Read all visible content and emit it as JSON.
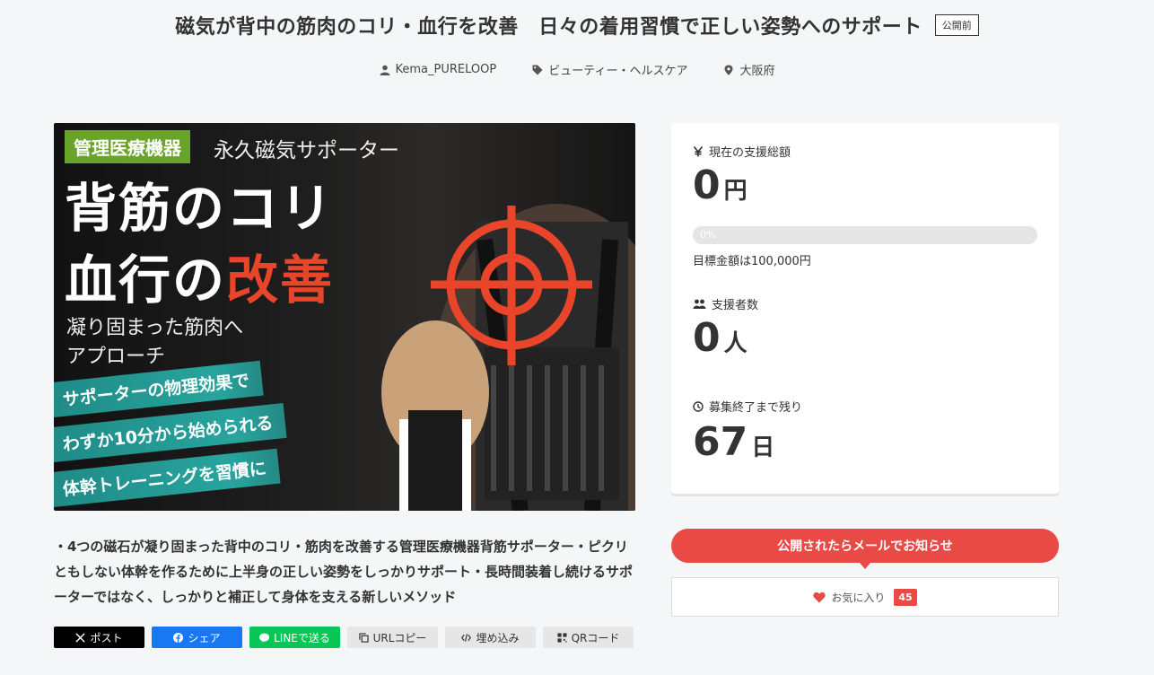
{
  "project": {
    "title": "磁気が背中の筋肉のコリ・血行を改善　日々の着用習慣で正しい姿勢へのサポート",
    "status_badge": "公開前",
    "owner": "Kema_PURELOOP",
    "category": "ビューティー・ヘルスケア",
    "location": "大阪府",
    "description": "・4つの磁石が凝り固まった背中のコリ・筋肉を改善する管理医療機器背筋サポーター・ピクリともしない体幹を作るために上半身の正しい姿勢をしっかりサポート・長時間装着し続けるサポーターではなく、しっかりと補正して身体を支える新しいメソッド"
  },
  "hero": {
    "tag": "管理医療機器",
    "tag_sub": "永久磁気サポーター",
    "headline_line1": "背筋のコリ",
    "headline_line2_a": "血行の",
    "headline_line2_b": "改善",
    "sub_line1": "凝り固まった筋肉へ",
    "sub_line2": "アプローチ",
    "band1": "サポーターの物理効果で",
    "band2": "わずか10分から始められる",
    "band3": "体幹トレーニングを習慣に",
    "accent_color": "#e8452b",
    "band_color": "#28a49e"
  },
  "share": {
    "x_label": "ポスト",
    "facebook_label": "シェア",
    "line_label": "LINEで送る",
    "url_label": "URLコピー",
    "embed_label": "埋め込み",
    "qr_label": "QRコード"
  },
  "stats": {
    "amount_label": "現在の支援総額",
    "amount_value": "0",
    "amount_unit": "円",
    "progress_percent_text": "0%",
    "progress_fraction": 0,
    "goal_text": "目標金額は100,000円",
    "backers_label": "支援者数",
    "backers_value": "0",
    "backers_unit": "人",
    "remaining_label": "募集終了まで残り",
    "remaining_value": "67",
    "remaining_unit": "日"
  },
  "actions": {
    "notify_label": "公開されたらメールでお知らせ",
    "favorite_label": "お気に入り",
    "favorite_count": "45"
  },
  "colors": {
    "brand_red": "#e94a45",
    "x": "#000000",
    "facebook": "#1877f2",
    "line": "#06c755"
  }
}
